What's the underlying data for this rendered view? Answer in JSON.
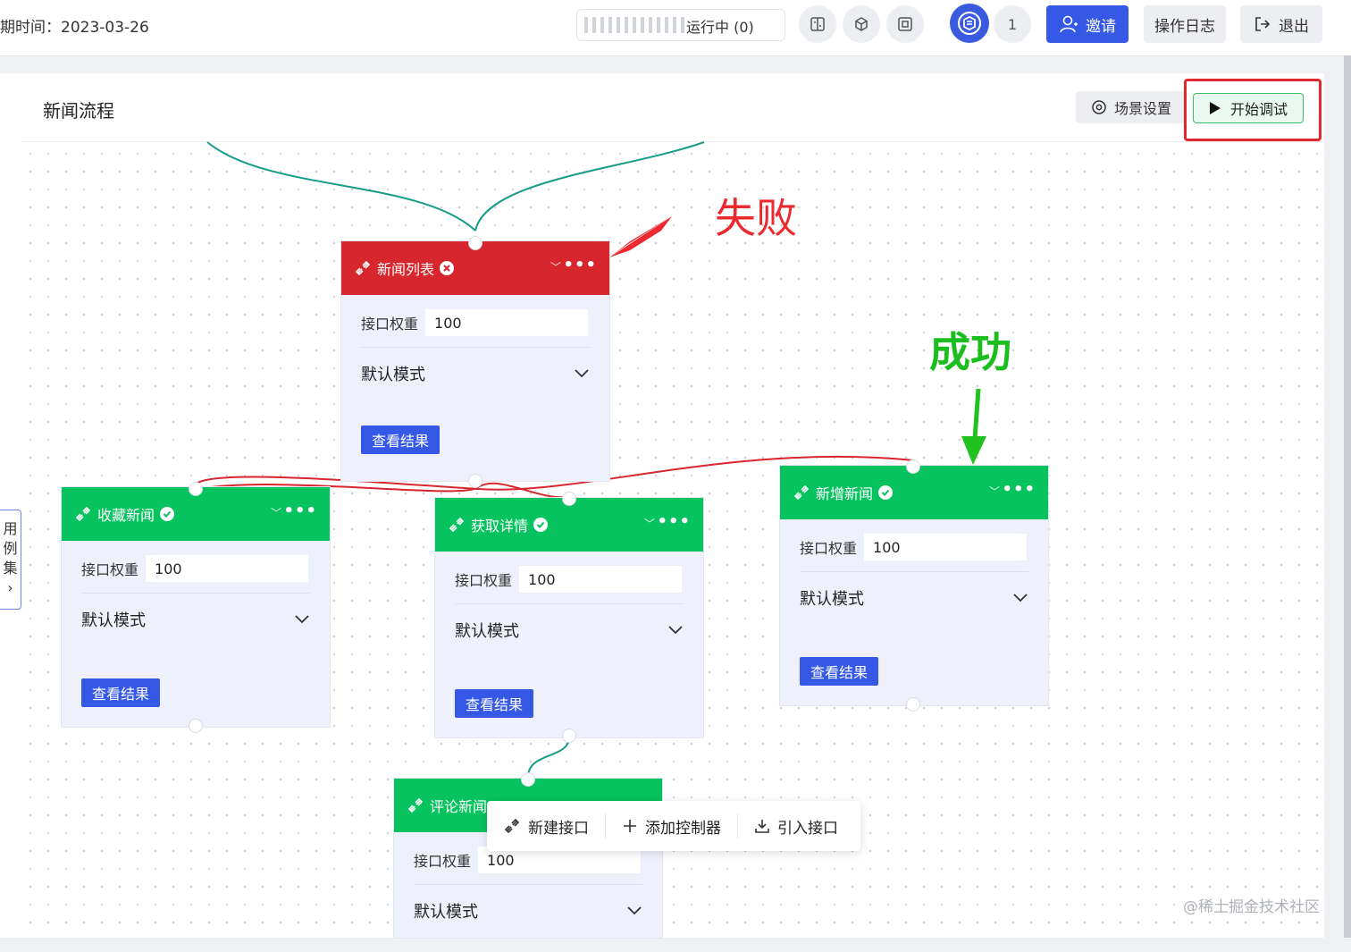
{
  "header": {
    "date_text": "期时间：2023-03-26",
    "run_status": "运行中  (0)",
    "member_count": "1",
    "invite_label": "邀请",
    "log_label": "操作日志",
    "exit_label": "退出"
  },
  "panel": {
    "title": "新闻流程",
    "scene_settings_label": "场景设置",
    "start_debug_label": "开始调试"
  },
  "side_tab": {
    "chars": [
      "用",
      "例",
      "集"
    ],
    "arrow": "›"
  },
  "nodes": {
    "news_list": {
      "title": "新闻列表",
      "status": "failed",
      "weight_label": "接口权重",
      "weight_value": "100",
      "mode": "默认模式",
      "result_button": "查看结果"
    },
    "favorite_news": {
      "title": "收藏新闻",
      "status": "success",
      "weight_label": "接口权重",
      "weight_value": "100",
      "mode": "默认模式",
      "result_button": "查看结果"
    },
    "get_detail": {
      "title": "获取详情",
      "status": "success",
      "weight_label": "接口权重",
      "weight_value": "100",
      "mode": "默认模式",
      "result_button": "查看结果"
    },
    "add_news": {
      "title": "新增新闻",
      "status": "success",
      "weight_label": "接口权重",
      "weight_value": "100",
      "mode": "默认模式",
      "result_button": "查看结果"
    },
    "comment_news": {
      "title": "评论新闻",
      "status": "success",
      "weight_label": "接口权重",
      "weight_value": "100",
      "mode": "默认模式"
    }
  },
  "context_menu": {
    "new_api": "新建接口",
    "add_controller": "添加控制器",
    "import_api": "引入接口"
  },
  "annotations": {
    "fail": "失败",
    "success": "成功"
  },
  "watermark": "@稀土掘金技术社区",
  "colors": {
    "success": "#06c35f",
    "fail": "#d8262e",
    "primary": "#3558e6"
  }
}
